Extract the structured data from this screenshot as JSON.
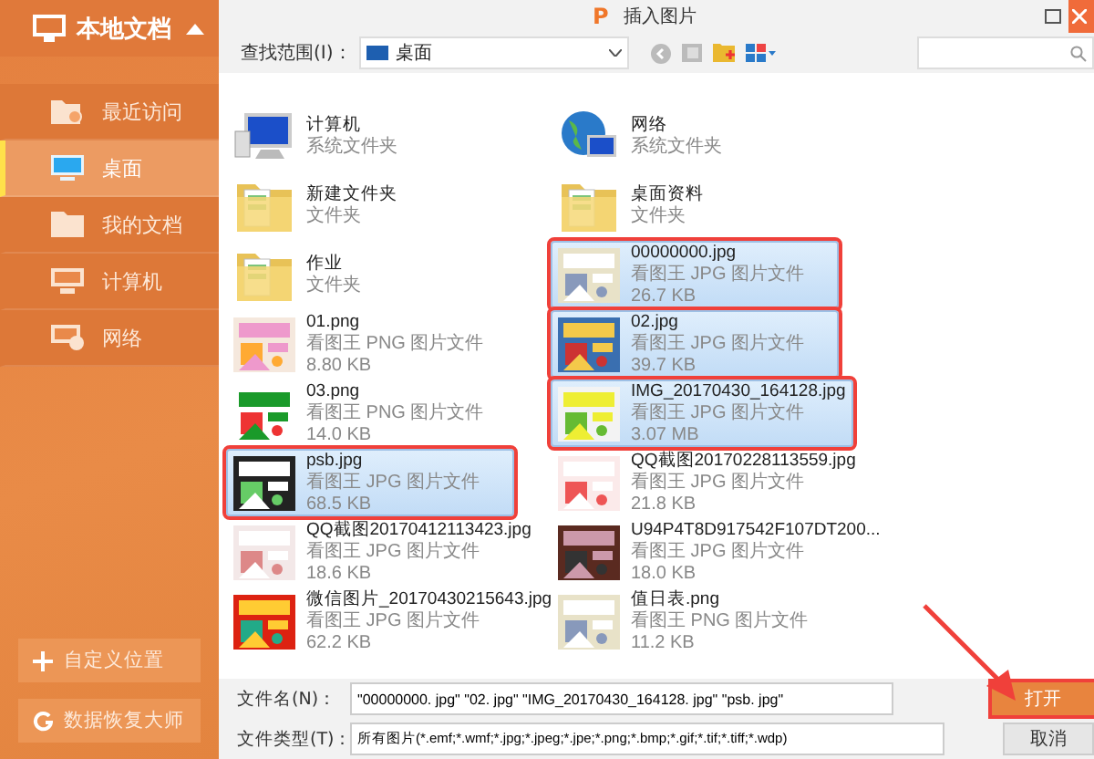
{
  "sidebar": {
    "header": "本地文档",
    "items": [
      {
        "label": "最近访问",
        "selected": false
      },
      {
        "label": "桌面",
        "selected": true
      },
      {
        "label": "我的文档",
        "selected": false
      },
      {
        "label": "计算机",
        "selected": false
      },
      {
        "label": "网络",
        "selected": false
      }
    ],
    "buttons": [
      {
        "label": "自定义位置"
      },
      {
        "label": "数据恢复大师"
      }
    ]
  },
  "window": {
    "logo": "P",
    "title": "插入图片"
  },
  "toolbar": {
    "look_in_label": "查找范围(I)：",
    "look_in_value": "桌面"
  },
  "files": [
    {
      "name": "计算机",
      "type": "系统文件夹",
      "kind": "computer",
      "selected": false,
      "marked": false
    },
    {
      "name": "网络",
      "type": "系统文件夹",
      "kind": "network",
      "selected": false,
      "marked": false
    },
    {
      "name": "新建文件夹",
      "type": "文件夹",
      "kind": "folder",
      "selected": false,
      "marked": false
    },
    {
      "name": "桌面资料",
      "type": "文件夹",
      "kind": "folder",
      "selected": false,
      "marked": false
    },
    {
      "name": "作业",
      "type": "文件夹",
      "kind": "folder",
      "selected": false,
      "marked": false
    },
    {
      "name": "00000000.jpg",
      "type": "看图王 JPG 图片文件",
      "size": "26.7 KB",
      "kind": "picture",
      "selected": true,
      "marked": true
    },
    {
      "name": "01.png",
      "type": "看图王 PNG 图片文件",
      "size": "8.80 KB",
      "kind": "picture",
      "selected": false,
      "marked": false
    },
    {
      "name": "02.jpg",
      "type": "看图王 JPG 图片文件",
      "size": "39.7 KB",
      "kind": "picture",
      "selected": true,
      "marked": true
    },
    {
      "name": "03.png",
      "type": "看图王 PNG 图片文件",
      "size": "14.0 KB",
      "kind": "picture",
      "selected": false,
      "marked": false
    },
    {
      "name": "IMG_20170430_164128.jpg",
      "type": "看图王 JPG 图片文件",
      "size": "3.07 MB",
      "kind": "picture",
      "selected": true,
      "marked": true
    },
    {
      "name": "psb.jpg",
      "type": "看图王 JPG 图片文件",
      "size": "68.5 KB",
      "kind": "picture",
      "selected": true,
      "marked": true
    },
    {
      "name": "QQ截图20170228113559.jpg",
      "type": "看图王 JPG 图片文件",
      "size": "21.8 KB",
      "kind": "picture",
      "selected": false,
      "marked": false
    },
    {
      "name": "QQ截图20170412113423.jpg",
      "type": "看图王 JPG 图片文件",
      "size": "18.6 KB",
      "kind": "picture",
      "selected": false,
      "marked": false
    },
    {
      "name": "U94P4T8D917542F107DT200...",
      "type": "看图王 JPG 图片文件",
      "size": "18.0 KB",
      "kind": "picture",
      "selected": false,
      "marked": false
    },
    {
      "name": "微信图片_20170430215643.jpg",
      "type": "看图王 JPG 图片文件",
      "size": "62.2 KB",
      "kind": "picture",
      "selected": false,
      "marked": false
    },
    {
      "name": "值日表.png",
      "type": "看图王 PNG 图片文件",
      "size": "11.2 KB",
      "kind": "picture",
      "selected": false,
      "marked": false
    }
  ],
  "filename": {
    "label": "文件名(N)：",
    "value": "\"00000000. jpg\" \"02. jpg\" \"IMG_20170430_164128. jpg\" \"psb. jpg\""
  },
  "filetype": {
    "label": "文件类型(T)：",
    "value": "所有图片(*.emf;*.wmf;*.jpg;*.jpeg;*.jpe;*.png;*.bmp;*.gif;*.tif;*.tiff;*.wdp)"
  },
  "open_button": {
    "label": "打开",
    "marked": true
  },
  "cancel_button": {
    "label": "取消"
  }
}
